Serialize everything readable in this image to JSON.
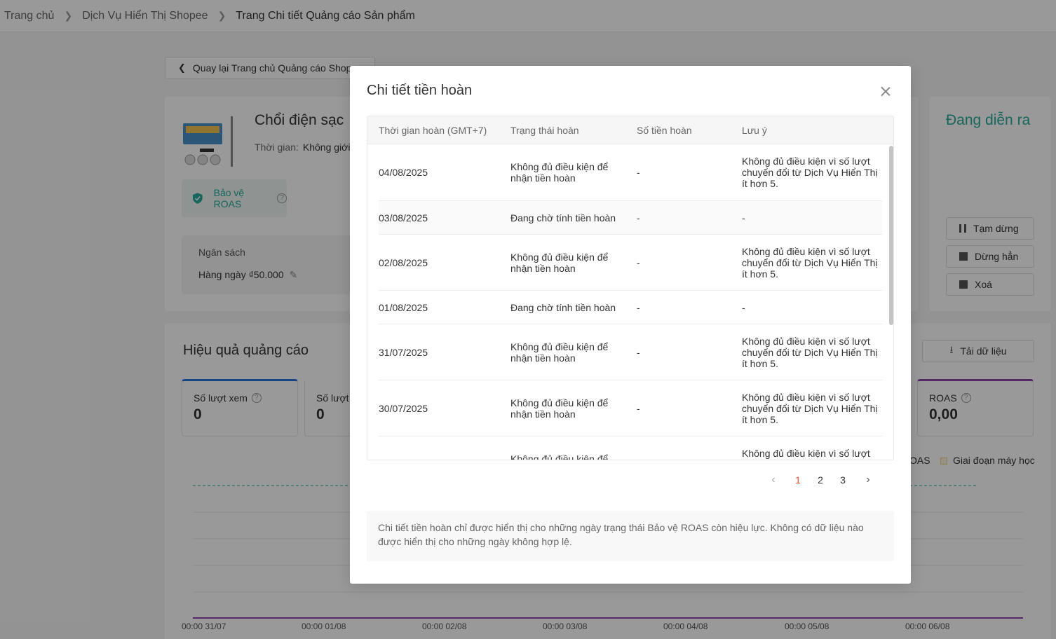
{
  "breadcrumb": [
    "Trang chủ",
    "Dịch Vụ Hiển Thị Shopee",
    "Trang Chi tiết Quảng cáo Sản phẩm"
  ],
  "back_label": "Quay lại Trang chủ Quảng cáo Shop",
  "product": {
    "title": "Chổi điện sạc",
    "time_label": "Thời gian:",
    "time_value": "Không giới",
    "roas_tag": "Bảo vệ ROAS",
    "budget_label": "Ngân sách",
    "budget_value": "Hàng ngày ₫50.000"
  },
  "status": {
    "text": "Đang diễn ra",
    "pause": "Tạm dừng",
    "stop": "Dừng hẳn",
    "delete": "Xoá"
  },
  "performance": {
    "title": "Hiệu quả quảng cáo",
    "download": "Tải dữ liệu",
    "metrics": [
      {
        "label": "Số lượt xem",
        "value": "0"
      },
      {
        "label": "Số lượt",
        "value": "0"
      },
      {
        "label": "ROAS",
        "value": "0,00"
      }
    ],
    "legend_roas": "OAS",
    "legend_learning": "Giai đoạn máy học",
    "x_ticks": [
      "00:00 31/07",
      "00:00 01/08",
      "00:00 02/08",
      "00:00 03/08",
      "00:00 04/08",
      "00:00 05/08",
      "00:00 06/08"
    ],
    "colors": {
      "views": "#2673dd",
      "roas": "#8e44ad",
      "reference": "#26aa99"
    }
  },
  "modal": {
    "title": "Chi tiết tiền hoàn",
    "headers": [
      "Thời gian hoàn (GMT+7)",
      "Trạng thái hoàn",
      "Số tiền hoàn",
      "Lưu ý"
    ],
    "rows": [
      {
        "date": "04/08/2025",
        "status": "Không đủ điều kiện để nhận tiền hoàn",
        "amount": "-",
        "note": "Không đủ điều kiện vì số lượt chuyển đổi từ Dịch Vụ Hiển Thị ít hơn 5."
      },
      {
        "date": "03/08/2025",
        "status": "Đang chờ tính tiền hoàn",
        "amount": "-",
        "note": "-"
      },
      {
        "date": "02/08/2025",
        "status": "Không đủ điều kiện để nhận tiền hoàn",
        "amount": "-",
        "note": "Không đủ điều kiện vì số lượt chuyển đổi từ Dịch Vụ Hiển Thị ít hơn 5."
      },
      {
        "date": "01/08/2025",
        "status": "Đang chờ tính tiền hoàn",
        "amount": "-",
        "note": "-"
      },
      {
        "date": "31/07/2025",
        "status": "Không đủ điều kiện để nhận tiền hoàn",
        "amount": "-",
        "note": "Không đủ điều kiện vì số lượt chuyển đổi từ Dịch Vụ Hiển Thị ít hơn 5."
      },
      {
        "date": "30/07/2025",
        "status": "Không đủ điều kiện để nhận tiền hoàn",
        "amount": "-",
        "note": "Không đủ điều kiện vì số lượt chuyển đổi từ Dịch Vụ Hiển Thị ít hơn 5."
      },
      {
        "date": "",
        "status": "Không đủ điều kiện để",
        "amount": "",
        "note": "Không đủ điều kiện vì số lượt"
      }
    ],
    "pagination": {
      "pages": [
        "1",
        "2",
        "3"
      ],
      "current": "1"
    },
    "note": "Chi tiết tiền hoàn chỉ được hiển thị cho những ngày trạng thái Bảo vệ ROAS còn hiệu lực. Không có dữ liệu nào được hiển thị cho những ngày không hợp lệ."
  }
}
